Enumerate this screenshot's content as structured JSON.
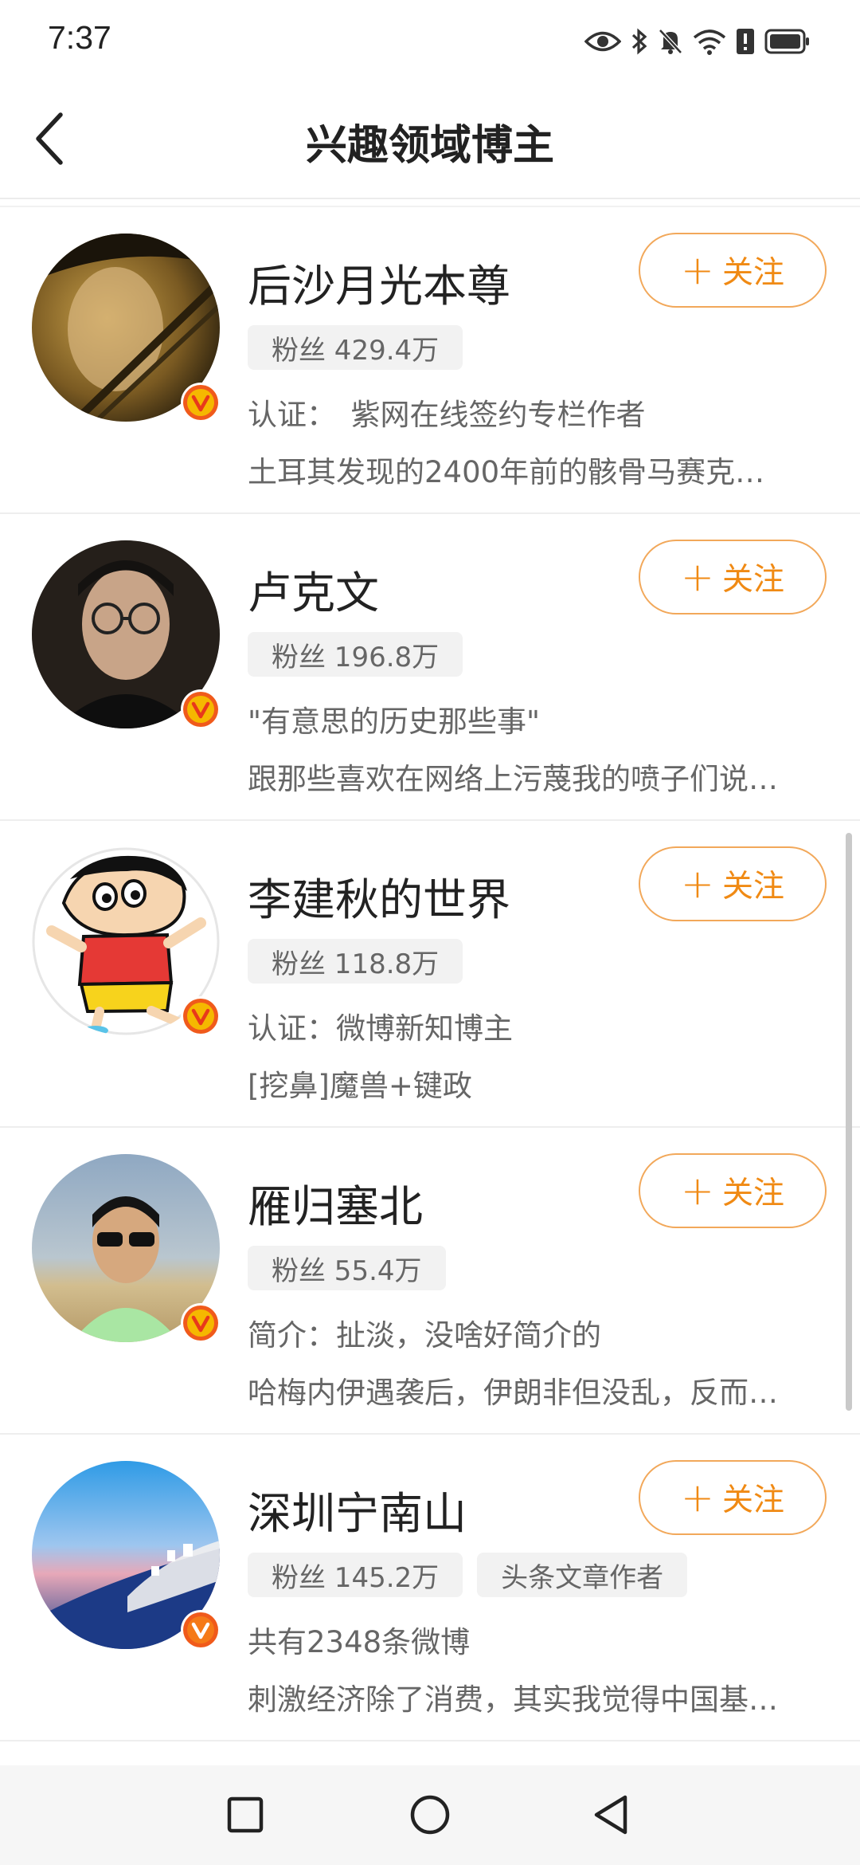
{
  "status_bar": {
    "time": "7:37",
    "icons": [
      "eye-icon",
      "bluetooth-icon",
      "mute-icon",
      "wifi-icon",
      "sim-alert-icon",
      "battery-icon"
    ]
  },
  "header": {
    "title": "兴趣领域博主",
    "back_icon": "chevron-left-icon"
  },
  "bloggers": [
    {
      "name": "后沙月光本尊",
      "follow_label": "关注",
      "tags": [
        "粉丝 429.4万"
      ],
      "line1": "认证：　紫网在线签约专栏作者",
      "line2": "土耳其发现的2400年前的骸骨马赛克…",
      "avatar_colors": [
        "#3a2c12",
        "#c9a14a"
      ]
    },
    {
      "name": "卢克文",
      "follow_label": "关注",
      "tags": [
        "粉丝 196.8万"
      ],
      "line1": "\"有意思的历史那些事\"",
      "line2": "跟那些喜欢在网络上污蔑我的喷子们说…",
      "avatar_colors": [
        "#1b1b1b",
        "#4a3b2e"
      ]
    },
    {
      "name": "李建秋的世界",
      "follow_label": "关注",
      "tags": [
        "粉丝 118.8万"
      ],
      "line1": "认证：微博新知博主",
      "line2": "[挖鼻]魔兽+键政",
      "avatar_colors": [
        "#ffffff",
        "#e53935"
      ]
    },
    {
      "name": "雁归塞北",
      "follow_label": "关注",
      "tags": [
        "粉丝 55.4万"
      ],
      "line1": "简介：扯淡，没啥好简介的",
      "line2": "哈梅内伊遇袭后，伊朗非但没乱，反而…",
      "avatar_colors": [
        "#9fb4c8",
        "#c7b38a"
      ]
    },
    {
      "name": "深圳宁南山",
      "follow_label": "关注",
      "tags": [
        "粉丝 145.2万",
        "头条文章作者"
      ],
      "line1": "共有2348条微博",
      "line2": "刺激经济除了消费，其实我觉得中国基…",
      "avatar_colors": [
        "#4aa8e8",
        "#1d3f8c"
      ]
    }
  ],
  "nav_bar": {
    "icons": [
      "recent-apps-icon",
      "home-icon",
      "back-icon"
    ]
  },
  "colors": {
    "accent": "#f08a14",
    "follow_border": "#f2a85a",
    "badge_fill": "#f5b800",
    "badge_outer": "#f05a1b"
  }
}
